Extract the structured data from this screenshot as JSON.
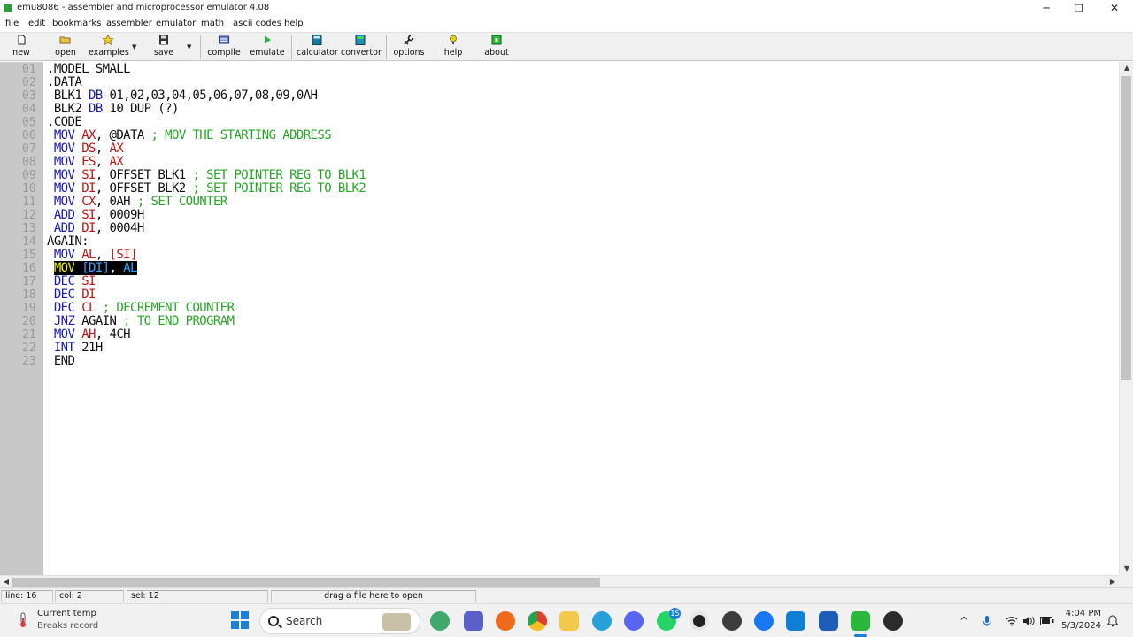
{
  "window": {
    "title": "emu8086 - assembler and microprocessor emulator 4.08",
    "controls": {
      "minimize": "─",
      "maximize": "❐",
      "close": "✕"
    }
  },
  "menu": {
    "items": [
      "file",
      "edit",
      "bookmarks",
      "assembler",
      "emulator",
      "math",
      "ascii codes",
      "help"
    ]
  },
  "toolbar": {
    "new": "new",
    "open": "open",
    "examples": "examples",
    "save": "save",
    "compile": "compile",
    "emulate": "emulate",
    "calculator": "calculator",
    "convertor": "convertor",
    "options": "options",
    "help": "help",
    "about": "about",
    "dropdown_arrow": "▼"
  },
  "editor": {
    "line_numbers": [
      "01",
      "02",
      "03",
      "04",
      "05",
      "06",
      "07",
      "08",
      "09",
      "10",
      "11",
      "12",
      "13",
      "14",
      "15",
      "16",
      "17",
      "18",
      "19",
      "20",
      "21",
      "22",
      "23"
    ],
    "lines": [
      [
        [
          ".MODEL SMALL",
          "tx"
        ]
      ],
      [
        [
          ".DATA",
          "tx"
        ]
      ],
      [
        [
          " BLK1 ",
          "tx"
        ],
        [
          "DB",
          "kw"
        ],
        [
          " 01,02,03,04,05,06,07,08,09,0AH",
          "tx"
        ]
      ],
      [
        [
          " BLK2 ",
          "tx"
        ],
        [
          "DB",
          "kw"
        ],
        [
          " 10 DUP (?)",
          "tx"
        ]
      ],
      [
        [
          ".CODE",
          "tx"
        ]
      ],
      [
        [
          " ",
          "tx"
        ],
        [
          "MOV",
          "kw"
        ],
        [
          " ",
          "tx"
        ],
        [
          "AX",
          "reg"
        ],
        [
          ", @DATA ",
          "tx"
        ],
        [
          "; MOV THE STARTING ADDRESS",
          "cm"
        ]
      ],
      [
        [
          " ",
          "tx"
        ],
        [
          "MOV",
          "kw"
        ],
        [
          " ",
          "tx"
        ],
        [
          "DS",
          "reg"
        ],
        [
          ", ",
          "tx"
        ],
        [
          "AX",
          "reg"
        ]
      ],
      [
        [
          " ",
          "tx"
        ],
        [
          "MOV",
          "kw"
        ],
        [
          " ",
          "tx"
        ],
        [
          "ES",
          "reg"
        ],
        [
          ", ",
          "tx"
        ],
        [
          "AX",
          "reg"
        ]
      ],
      [
        [
          " ",
          "tx"
        ],
        [
          "MOV",
          "kw"
        ],
        [
          " ",
          "tx"
        ],
        [
          "SI",
          "reg"
        ],
        [
          ", OFFSET BLK1 ",
          "tx"
        ],
        [
          "; SET POINTER REG TO BLK1",
          "cm"
        ]
      ],
      [
        [
          " ",
          "tx"
        ],
        [
          "MOV",
          "kw"
        ],
        [
          " ",
          "tx"
        ],
        [
          "DI",
          "reg"
        ],
        [
          ", OFFSET BLK2 ",
          "tx"
        ],
        [
          "; SET POINTER REG TO BLK2",
          "cm"
        ]
      ],
      [
        [
          " ",
          "tx"
        ],
        [
          "MOV",
          "kw"
        ],
        [
          " ",
          "tx"
        ],
        [
          "CX",
          "reg"
        ],
        [
          ", 0AH ",
          "tx"
        ],
        [
          "; SET COUNTER",
          "cm"
        ]
      ],
      [
        [
          " ",
          "tx"
        ],
        [
          "ADD",
          "kw"
        ],
        [
          " ",
          "tx"
        ],
        [
          "SI",
          "reg"
        ],
        [
          ", 0009H",
          "tx"
        ]
      ],
      [
        [
          " ",
          "tx"
        ],
        [
          "ADD",
          "kw"
        ],
        [
          " ",
          "tx"
        ],
        [
          "DI",
          "reg"
        ],
        [
          ", 0004H",
          "tx"
        ]
      ],
      [
        [
          "AGAIN:",
          "tx"
        ]
      ],
      [
        [
          " ",
          "tx"
        ],
        [
          "MOV",
          "kw"
        ],
        [
          " ",
          "tx"
        ],
        [
          "AL",
          "reg"
        ],
        [
          ", ",
          "tx"
        ],
        [
          "[SI]",
          "reg"
        ]
      ],
      [
        [
          " ",
          "tx"
        ],
        [
          "MOV",
          "sel-kw"
        ],
        [
          " ",
          "sel-tx"
        ],
        [
          "[DI]",
          "sel-reg"
        ],
        [
          ", ",
          "sel-tx"
        ],
        [
          "AL",
          "sel-reg"
        ]
      ],
      [
        [
          " ",
          "tx"
        ],
        [
          "DEC",
          "kw"
        ],
        [
          " ",
          "tx"
        ],
        [
          "SI",
          "reg"
        ]
      ],
      [
        [
          " ",
          "tx"
        ],
        [
          "DEC",
          "kw"
        ],
        [
          " ",
          "tx"
        ],
        [
          "DI",
          "reg"
        ]
      ],
      [
        [
          " ",
          "tx"
        ],
        [
          "DEC",
          "kw"
        ],
        [
          " ",
          "tx"
        ],
        [
          "CL",
          "reg"
        ],
        [
          " ",
          "tx"
        ],
        [
          "; DECREMENT COUNTER",
          "cm"
        ]
      ],
      [
        [
          " ",
          "tx"
        ],
        [
          "JNZ",
          "kw"
        ],
        [
          " AGAIN ",
          "tx"
        ],
        [
          "; TO END PROGRAM",
          "cm"
        ]
      ],
      [
        [
          " ",
          "tx"
        ],
        [
          "MOV",
          "kw"
        ],
        [
          " ",
          "tx"
        ],
        [
          "AH",
          "reg"
        ],
        [
          ", 4CH",
          "tx"
        ]
      ],
      [
        [
          " ",
          "tx"
        ],
        [
          "INT",
          "kw"
        ],
        [
          " 21H",
          "tx"
        ]
      ],
      [
        [
          " END",
          "tx"
        ]
      ]
    ]
  },
  "scrollbar": {
    "up": "▲",
    "down": "▼",
    "left": "◀",
    "right": "▶"
  },
  "statusbar": {
    "line": "line: 16",
    "col": "col: 2",
    "sel": "sel: 12",
    "hint": "drag a file here to open"
  },
  "taskbar": {
    "weather_title": "Current temp",
    "weather_sub": "Breaks record",
    "search_placeholder": "Search",
    "whatsapp_badge": "15",
    "clock_time": "4:04 PM",
    "clock_date": "5/3/2024",
    "tray_chevron": "^"
  },
  "colors": {
    "keyword": "#1a1ab4",
    "register": "#c41414",
    "comment": "#2aa52a",
    "gutter": "#c8c8c8",
    "accent": "#1a7fd6"
  }
}
